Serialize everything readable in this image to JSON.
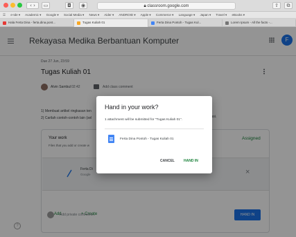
{
  "browser": {
    "url": "classroom.google.com",
    "favorites": [
      "e-Ide ▾",
      "Academic ▾",
      "Google ▾",
      "Social Media ▾",
      "News ▾",
      "Aider ▾",
      "ANDROID ▾",
      "Apple ▾",
      "Commerce ▾",
      "Language ▾",
      "Japan ▾",
      "Travel ▾",
      "eBooks ▾"
    ],
    "tabs": [
      {
        "label": "Hala Ferta Dina - ferta.dina.pont...",
        "color": "#e53935"
      },
      {
        "label": "Tugas Kuliah 01",
        "color": "#f9a825"
      },
      {
        "label": "Ferta Dina Pontoh - Tugas Kul...",
        "color": "#4285f4"
      },
      {
        "label": "Lorem Ipsum - All the facts -...",
        "color": "#757575"
      }
    ]
  },
  "header": {
    "course_title": "Rekayasa Medika Berbantuan Komputer",
    "avatar_letter": "F"
  },
  "assignment": {
    "due": "Due 27 Jun, 23:59",
    "title": "Tugas Kuliah 01",
    "author": "Alvin Sambul",
    "time": "02:42",
    "add_comment": "Add class comment",
    "instructions": [
      "1) Membuat artikel ringkasan ten",
      "2) Carilah contoh-contoh lain (sel"
    ],
    "instructions_tail": "kasi."
  },
  "work": {
    "heading": "Your work",
    "subtitle": "Files that you add or create w",
    "status": "Assigned",
    "attachment_title": "Ferta Di",
    "attachment_sub": "Google",
    "remove_symbol": "×",
    "add_label": "+ Add",
    "create_label": "+ Create",
    "handin_label": "HAND IN",
    "private_comment": "Add private comment..."
  },
  "help_symbol": "?",
  "dialog": {
    "title": "Hand in your work?",
    "message": "1 attachment will be submitted for \"Tugas Kuliah 01\".",
    "file_name": "Ferta Dina Pontoh - Tugas Kuliah 01",
    "cancel_label": "CANCEL",
    "handin_label": "HAND IN"
  }
}
